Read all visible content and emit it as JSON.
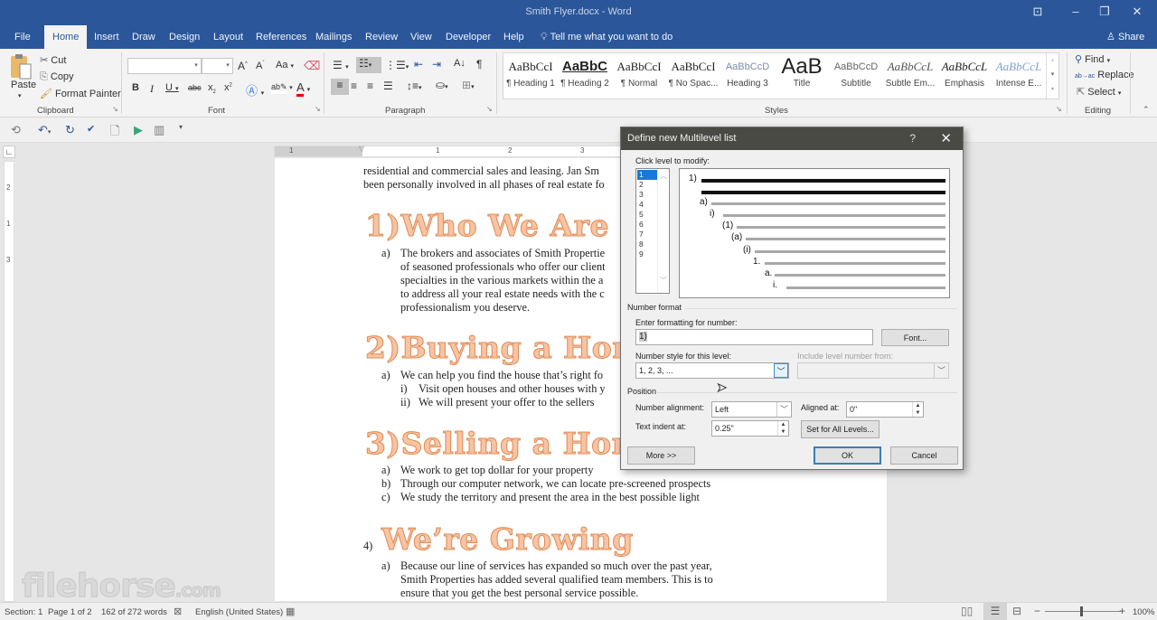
{
  "window": {
    "title": "Smith Flyer.docx - Word",
    "controls": [
      "ribbon-display",
      "minimize",
      "restore",
      "close"
    ]
  },
  "tabs": [
    "File",
    "Home",
    "Insert",
    "Draw",
    "Design",
    "Layout",
    "References",
    "Mailings",
    "Review",
    "View",
    "Developer",
    "Help"
  ],
  "active_tab": "Home",
  "tell_me": "Tell me what you want to do",
  "share": "Share",
  "ribbon": {
    "clipboard": {
      "paste": "Paste",
      "cut": "Cut",
      "copy": "Copy",
      "format_painter": "Format Painter",
      "label": "Clipboard"
    },
    "font": {
      "family_value": "",
      "size_value": "",
      "change_case": "Aa",
      "label": "Font"
    },
    "paragraph": {
      "label": "Paragraph"
    },
    "styles": {
      "label": "Styles",
      "items": [
        {
          "preview": "AaBbCcI",
          "name": "¶ Heading 1"
        },
        {
          "preview": "AaBbC",
          "name": "¶ Heading 2"
        },
        {
          "preview": "AaBbCcI",
          "name": "¶ Normal"
        },
        {
          "preview": "AaBbCcI",
          "name": "¶ No Spac..."
        },
        {
          "preview": "AaBbCcD",
          "name": "Heading 3"
        },
        {
          "preview": "AaB",
          "name": "Title"
        },
        {
          "preview": "AaBbCcD",
          "name": "Subtitle"
        },
        {
          "preview": "AaBbCcL",
          "name": "Subtle Em..."
        },
        {
          "preview": "AaBbCcL",
          "name": "Emphasis"
        },
        {
          "preview": "AaBbCcL",
          "name": "Intense E..."
        }
      ]
    },
    "editing": {
      "find": "Find",
      "replace": "Replace",
      "select": "Select",
      "label": "Editing"
    }
  },
  "ruler": {
    "numbers": [
      "1",
      "1",
      "2",
      "3"
    ],
    "vertical_numbers": [
      "2",
      "1",
      "3"
    ]
  },
  "document": {
    "intro_lines": [
      "residential and commercial sales and leasing. Jan Sm",
      "been personally involved in all phases of real estate fo"
    ],
    "sections": [
      {
        "heading": "1)Who We Are",
        "items": [
          {
            "num": "a)",
            "lines": [
              "The brokers and associates of Smith Propertie",
              "of seasoned professionals who offer our client",
              "specialties in the various markets within the a",
              "to address all your real estate needs with the c",
              "professionalism you deserve."
            ]
          }
        ]
      },
      {
        "heading": "2)Buying a Hom",
        "items": [
          {
            "num": "a)",
            "lines": [
              "We can help you find the house that’s right fo"
            ]
          },
          {
            "num": "i)",
            "lines": [
              "Visit open houses and other houses with y"
            ]
          },
          {
            "num": "ii)",
            "lines": [
              "We will present your offer to the sellers"
            ]
          }
        ]
      },
      {
        "heading": "3)Selling a Hom",
        "items": [
          {
            "num": "a)",
            "lines": [
              "We work to get top dollar for your property"
            ]
          },
          {
            "num": "b)",
            "lines": [
              "Through our computer network, we can locate pre-screened prospects"
            ]
          },
          {
            "num": "c)",
            "lines": [
              "We study the territory and present the area in the best possible light"
            ]
          }
        ]
      },
      {
        "number": "4)",
        "heading": "We’re Growing",
        "items": [
          {
            "num": "a)",
            "lines": [
              "Because our line of services has expanded so much over the past year,",
              "Smith Properties has added several qualified team members. This is to",
              "ensure that you get the best personal service possible."
            ]
          }
        ]
      }
    ]
  },
  "dialog": {
    "title": "Define new Multilevel list",
    "help": "?",
    "click_level_label": "Click level to modify:",
    "levels": [
      "1",
      "2",
      "3",
      "4",
      "5",
      "6",
      "7",
      "8",
      "9"
    ],
    "selected_level": "1",
    "preview_numbers": [
      "1)",
      "a)",
      "i)",
      "(1)",
      "(a)",
      "(i)",
      "1.",
      "a.",
      "i."
    ],
    "number_format_section": "Number format",
    "enter_formatting_label": "Enter formatting for number:",
    "formatting_value": "1)",
    "font_button": "Font...",
    "number_style_label": "Number style for this level:",
    "number_style_value": "1, 2, 3, ...",
    "include_level_label": "Include level number from:",
    "include_level_value": "",
    "position_section": "Position",
    "number_alignment_label": "Number alignment:",
    "number_alignment_value": "Left",
    "aligned_at_label": "Aligned at:",
    "aligned_at_value": "0\"",
    "text_indent_label": "Text indent at:",
    "text_indent_value": "0.25\"",
    "set_all_levels": "Set for All Levels...",
    "more_button": "More >>",
    "ok_button": "OK",
    "cancel_button": "Cancel"
  },
  "status": {
    "section": "Section: 1",
    "page": "Page 1 of 2",
    "words": "162 of 272 words",
    "language": "English (United States)",
    "zoom": "100%"
  },
  "watermark": {
    "main": "filehorse",
    "suffix": ".com"
  },
  "colors": {
    "brand": "#2b579a",
    "wordart_fill": "#f8c4a2",
    "wordart_stroke": "#e08a55",
    "selection": "#1979d6"
  }
}
